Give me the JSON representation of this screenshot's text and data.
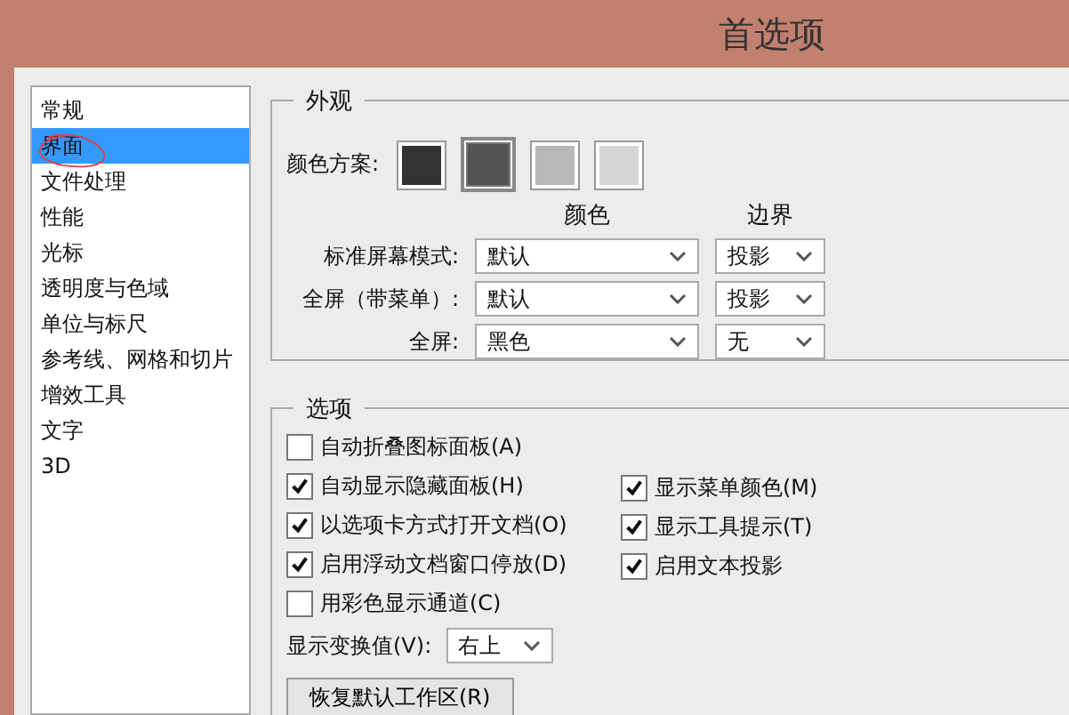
{
  "window": {
    "title": "首选项"
  },
  "sidebar": {
    "items": [
      {
        "label": "常规",
        "selected": false
      },
      {
        "label": "界面",
        "selected": true
      },
      {
        "label": "文件处理",
        "selected": false
      },
      {
        "label": "性能",
        "selected": false
      },
      {
        "label": "光标",
        "selected": false
      },
      {
        "label": "透明度与色域",
        "selected": false
      },
      {
        "label": "单位与标尺",
        "selected": false
      },
      {
        "label": "参考线、网格和切片",
        "selected": false
      },
      {
        "label": "增效工具",
        "selected": false
      },
      {
        "label": "文字",
        "selected": false
      },
      {
        "label": "3D",
        "selected": false
      }
    ]
  },
  "appearance": {
    "title": "外观",
    "scheme_label": "颜色方案:",
    "swatches": [
      {
        "color": "#333333",
        "selected": false
      },
      {
        "color": "#535353",
        "selected": true
      },
      {
        "color": "#b8b8b8",
        "selected": false
      },
      {
        "color": "#d6d6d6",
        "selected": false
      }
    ],
    "columns": [
      "颜色",
      "边界"
    ],
    "rows": [
      {
        "label": "标准屏幕模式:",
        "color_mode": "默认",
        "border": "投影"
      },
      {
        "label": "全屏（带菜单）:",
        "color_mode": "默认",
        "border": "投影"
      },
      {
        "label": "全屏:",
        "color_mode": "黑色",
        "border": "无"
      }
    ]
  },
  "options": {
    "title": "选项",
    "left": [
      {
        "label": "自动折叠图标面板(A)",
        "checked": false
      },
      {
        "label": "自动显示隐藏面板(H)",
        "checked": true
      },
      {
        "label": "以选项卡方式打开文档(O)",
        "checked": true
      },
      {
        "label": "启用浮动文档窗口停放(D)",
        "checked": true
      },
      {
        "label": "用彩色显示通道(C)",
        "checked": false
      }
    ],
    "right": [
      {
        "label": "显示菜单颜色(M)",
        "checked": true
      },
      {
        "label": "显示工具提示(T)",
        "checked": true
      },
      {
        "label": "启用文本投影",
        "checked": true
      }
    ],
    "transform_label": "显示变换值(V):",
    "transform_value": "右上",
    "reset_button": "恢复默认工作区(R)"
  }
}
